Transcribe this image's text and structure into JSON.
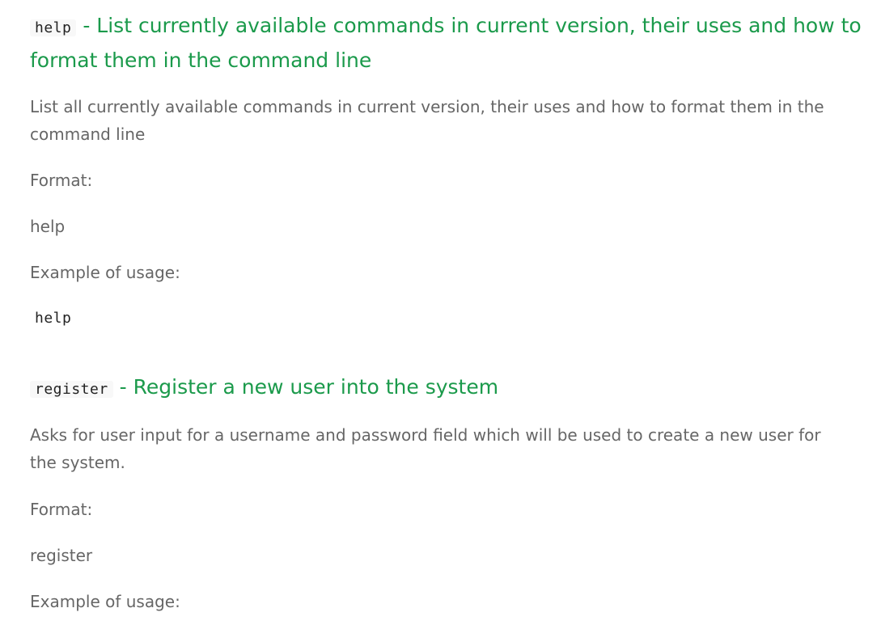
{
  "sections": [
    {
      "command": "help",
      "separator": "-",
      "title": "List currently available commands in current version, their uses and how to format them in the command line",
      "description": "List all currently available commands in current version, their uses and how to format them in the command line",
      "format_label": "Format:",
      "format_value": "help",
      "example_label": "Example of usage:",
      "example_code": "help"
    },
    {
      "command": "register",
      "separator": "-",
      "title": "Register a new user into the system",
      "description": "Asks for user input for a username and password field which will be used to create a new user for the system.",
      "format_label": "Format:",
      "format_value": "register",
      "example_label": "Example of usage:"
    }
  ],
  "colors": {
    "heading": "#1b9a4b",
    "body_text": "#666666",
    "code_text": "#222222"
  }
}
